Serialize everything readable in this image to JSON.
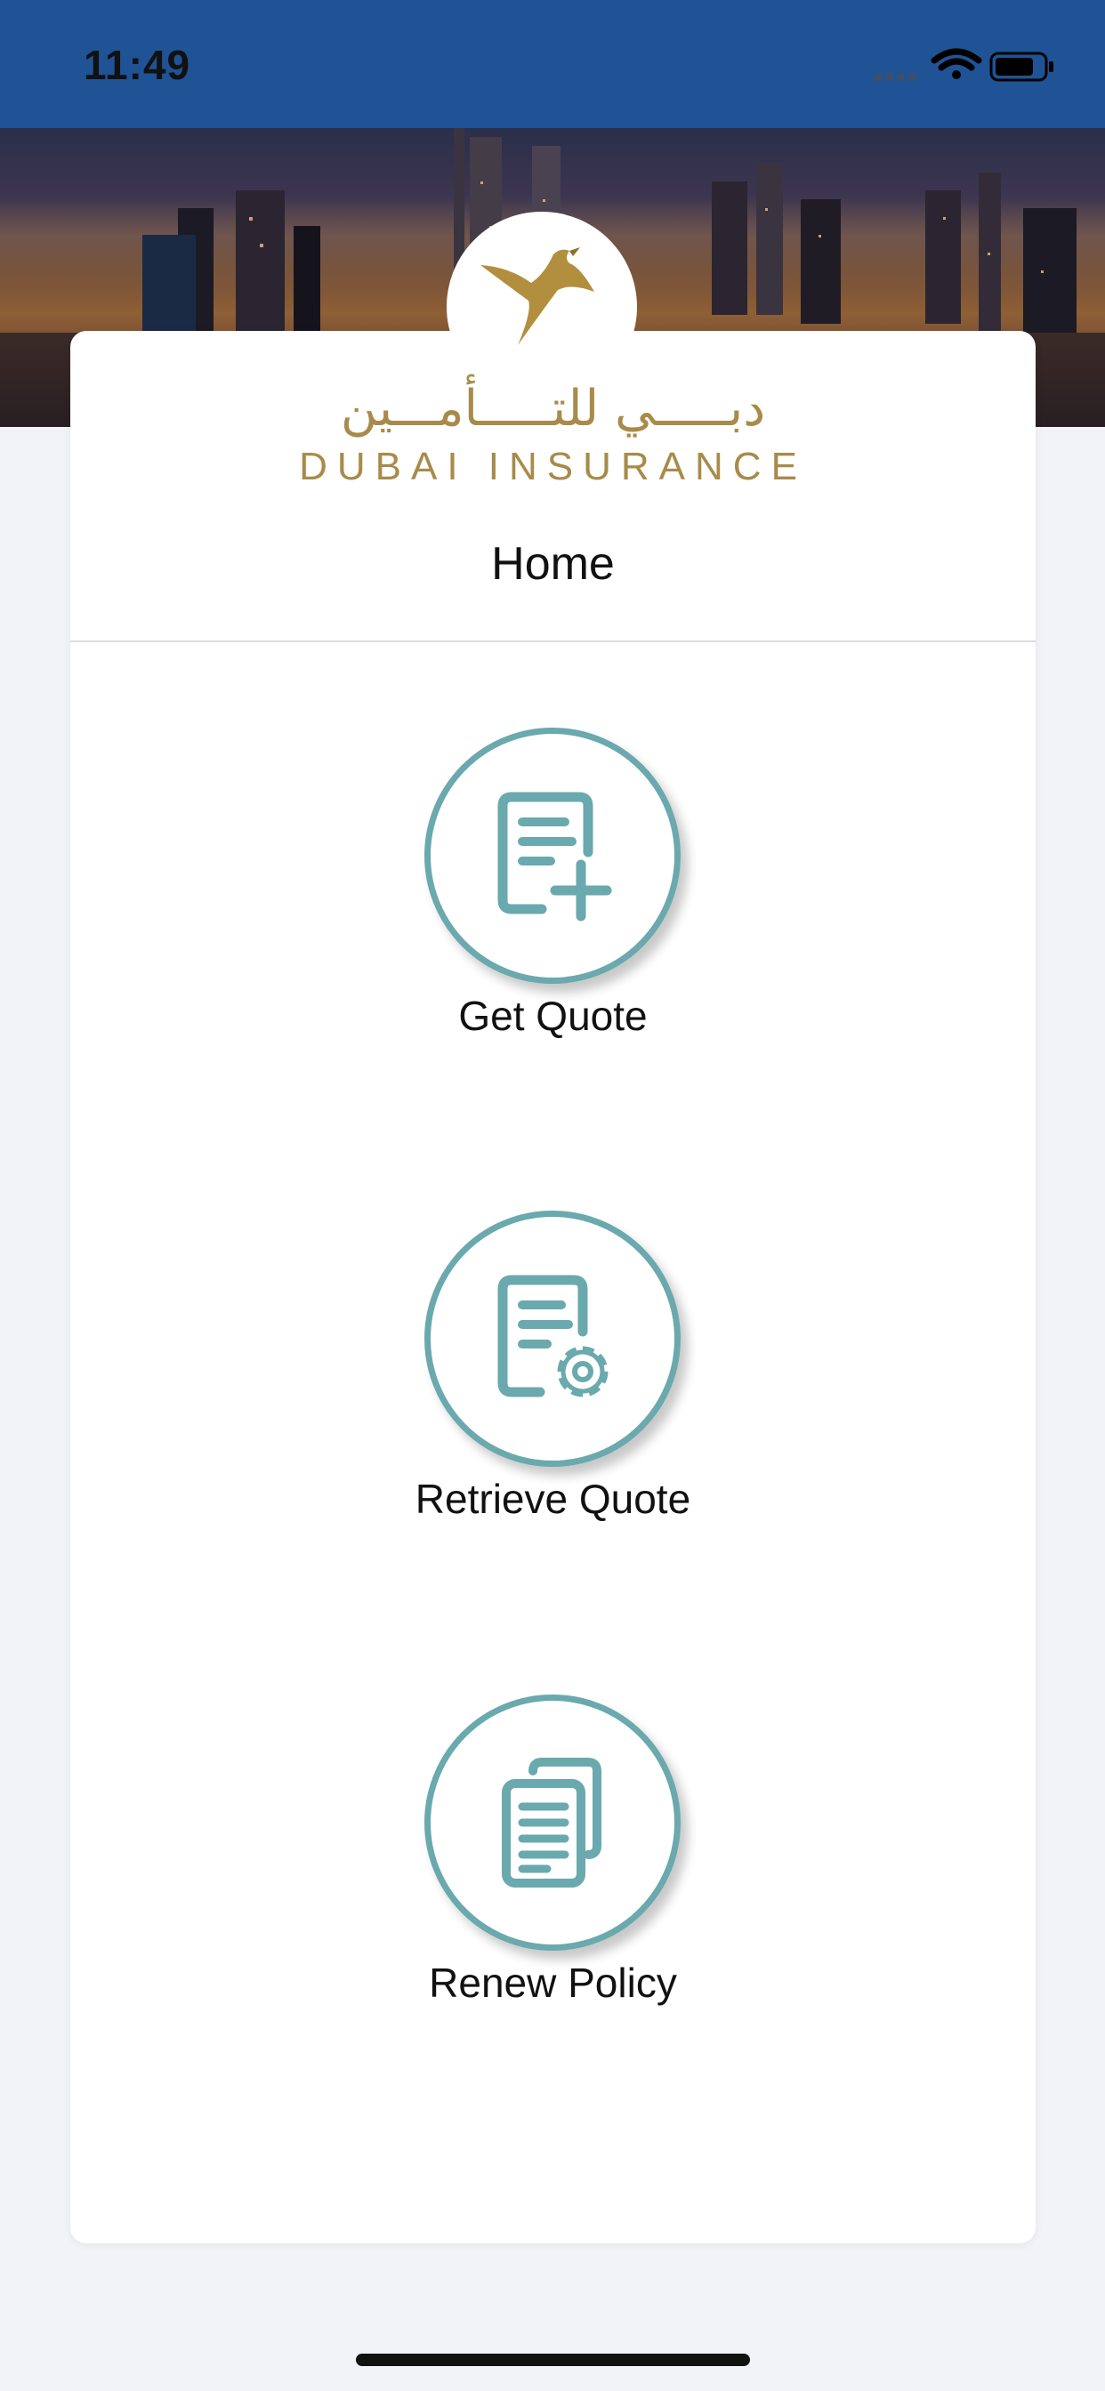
{
  "status_bar": {
    "time": "11:49",
    "icons": [
      "signal-icon",
      "wifi-icon",
      "battery-icon"
    ],
    "background_color": "#1f5395"
  },
  "hero": {
    "image": "dubai-skyline-night"
  },
  "brand": {
    "arabic_name": "دبـــــي للتـــــأمـــين",
    "english_name": "DUBAI INSURANCE",
    "logo_icon": "falcon-logo-icon",
    "color": "#a88b4a"
  },
  "page": {
    "title": "Home"
  },
  "actions": [
    {
      "label": "Get Quote",
      "icon": "document-add-icon"
    },
    {
      "label": "Retrieve Quote",
      "icon": "document-settings-icon"
    },
    {
      "label": "Renew Policy",
      "icon": "documents-copy-icon"
    }
  ],
  "accent_color": "#6aa9ad"
}
